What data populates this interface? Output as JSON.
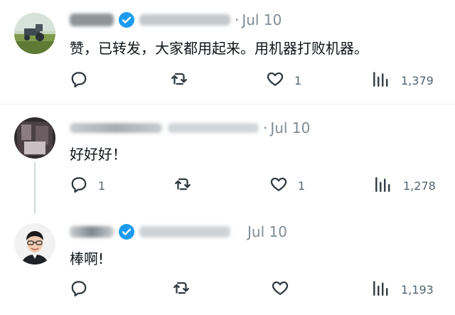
{
  "tweets": [
    {
      "date": "Jul 10",
      "separator": "·",
      "text": "赞，已转发，大家都用起来。用机器打败机器。",
      "reply_count": "",
      "retweet_count": "",
      "like_count": "1",
      "view_count": "1,379",
      "verified": true
    },
    {
      "date": "Jul 10",
      "separator": "·",
      "text": "好好好！",
      "reply_count": "1",
      "retweet_count": "",
      "like_count": "1",
      "view_count": "1,278",
      "verified": false
    },
    {
      "date": "Jul 10",
      "separator": "",
      "text": "棒啊!",
      "reply_count": "",
      "retweet_count": "",
      "like_count": "",
      "view_count": "1,193",
      "verified": true
    }
  ],
  "icons": {
    "reply": "reply-icon",
    "retweet": "retweet-icon",
    "like": "heart-icon",
    "views": "views-bar-chart-icon",
    "verified": "verified-badge-icon"
  },
  "colors": {
    "verified": "#1d9bf0",
    "muted": "#536471",
    "thread_line": "#cfd9de"
  }
}
